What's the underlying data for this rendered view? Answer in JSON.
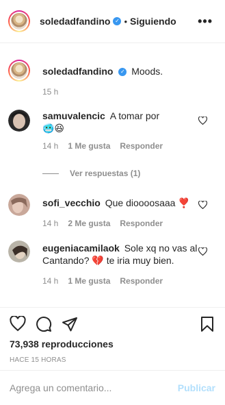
{
  "header": {
    "username": "soledadfandino",
    "separator": "•",
    "follow_label": "Siguiendo",
    "more_icon": "more-horizontal-icon"
  },
  "caption": {
    "username": "soledadfandino",
    "text": "Moods.",
    "time": "15 h"
  },
  "comments": [
    {
      "username": "samuvalencic",
      "text": "A tomar por",
      "emoji": "🥶😆",
      "time": "14 h",
      "likes": "1 Me gusta",
      "reply": "Responder"
    },
    {
      "username": "sofi_vecchio",
      "text": "Que dioooosaaa",
      "emoji": "❣️",
      "time": "14 h",
      "likes": "2 Me gusta",
      "reply": "Responder"
    },
    {
      "username": "eugeniacamilaok",
      "text": "Sole xq no vas al Cantando?",
      "text2": "te iria muy bien.",
      "emoji": "💔",
      "time": "14 h",
      "likes": "1 Me gusta",
      "reply": "Responder"
    }
  ],
  "view_replies": "Ver respuestas (1)",
  "actions": {
    "views": "73,938 reproducciones",
    "posted": "HACE 15 HORAS"
  },
  "add_comment": {
    "placeholder": "Agrega un comentario...",
    "publish_label": "Publicar"
  }
}
